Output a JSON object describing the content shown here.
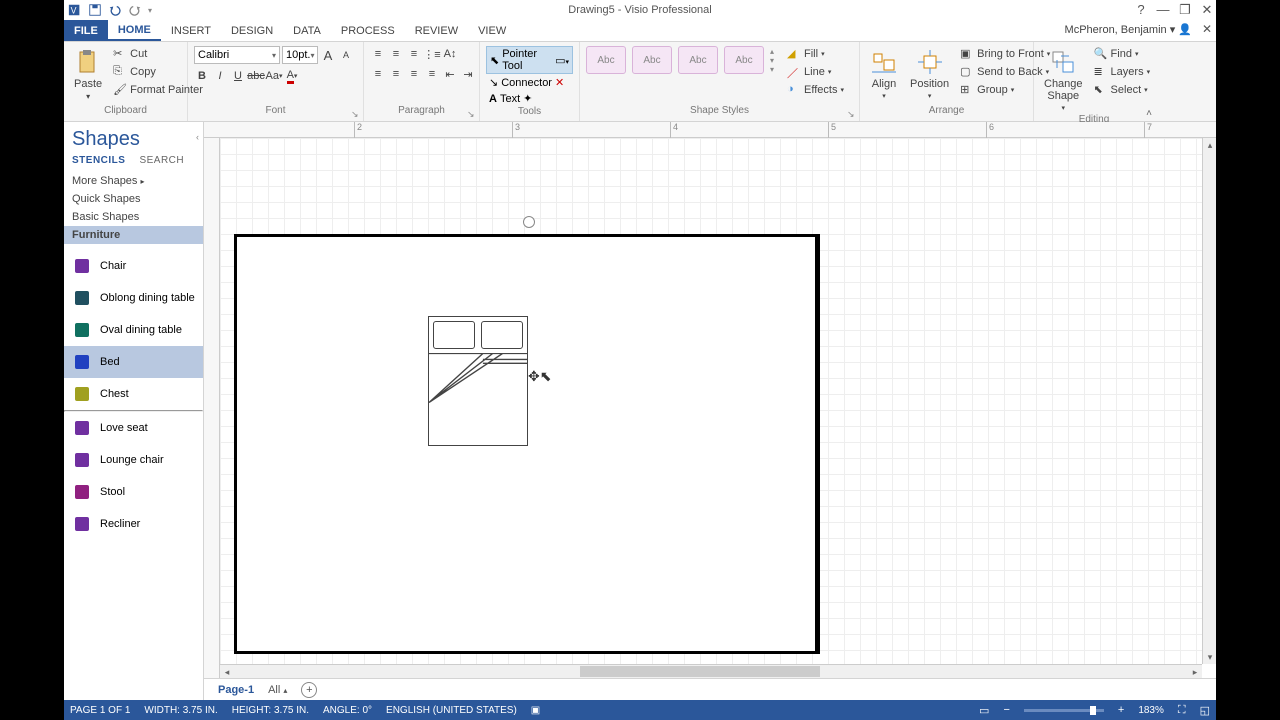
{
  "title": "Drawing5 - Visio Professional",
  "user": "McPheron, Benjamin",
  "tabs": {
    "file": "FILE",
    "home": "HOME",
    "insert": "INSERT",
    "design": "DESIGN",
    "data": "DATA",
    "process": "PROCESS",
    "review": "REVIEW",
    "view": "VIEW"
  },
  "clipboard": {
    "paste": "Paste",
    "cut": "Cut",
    "copy": "Copy",
    "format_painter": "Format Painter",
    "label": "Clipboard"
  },
  "font": {
    "name": "Calibri",
    "size": "10pt.",
    "label": "Font"
  },
  "paragraph": {
    "label": "Paragraph"
  },
  "tools": {
    "pointer": "Pointer Tool",
    "connector": "Connector",
    "text": "Text",
    "label": "Tools"
  },
  "shape_styles": {
    "abc": "Abc",
    "fill": "Fill",
    "line": "Line",
    "effects": "Effects",
    "label": "Shape Styles"
  },
  "arrange": {
    "align": "Align",
    "position": "Position",
    "bring_front": "Bring to Front",
    "send_back": "Send to Back",
    "group": "Group",
    "label": "Arrange"
  },
  "editing": {
    "change_shape": "Change\nShape",
    "find": "Find",
    "layers": "Layers",
    "select": "Select",
    "label": "Editing"
  },
  "shapes_pane": {
    "title": "Shapes",
    "tab_stencils": "STENCILS",
    "tab_search": "SEARCH",
    "more": "More Shapes",
    "quick": "Quick Shapes",
    "basic": "Basic Shapes",
    "furniture": "Furniture",
    "items": [
      "Chair",
      "Oblong dining table",
      "Oval dining table",
      "Bed",
      "Chest",
      "Love seat",
      "Lounge chair",
      "Stool",
      "Recliner"
    ],
    "selected": "Bed"
  },
  "ruler_marks": [
    "2",
    "3",
    "4",
    "5",
    "6",
    "7"
  ],
  "page_tabs": {
    "page1": "Page-1",
    "all": "All"
  },
  "status": {
    "page": "PAGE 1 OF 1",
    "width": "WIDTH: 3.75 IN.",
    "height": "HEIGHT: 3.75 IN.",
    "angle": "ANGLE: 0°",
    "lang": "ENGLISH (UNITED STATES)",
    "zoom": "183%"
  }
}
